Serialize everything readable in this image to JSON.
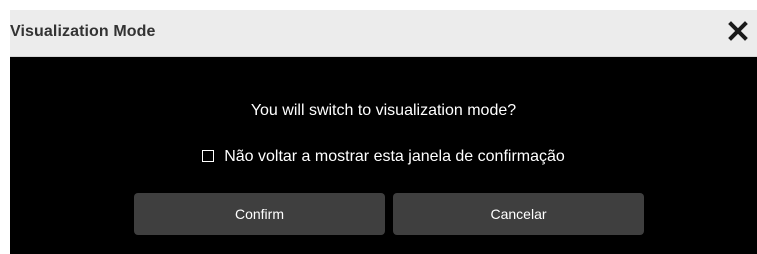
{
  "dialog": {
    "title": "Visualization Mode",
    "close_icon": "close-icon",
    "question": "You will switch to visualization mode?",
    "dont_show_label": "Não voltar a mostrar esta janela de confirmação",
    "dont_show_checked": false,
    "confirm_label": "Confirm",
    "cancel_label": "Cancelar"
  },
  "colors": {
    "titlebar_bg": "#ececec",
    "body_bg": "#000000",
    "button_bg": "#3f3f3f",
    "text_light": "#ffffff",
    "title_text": "#333333"
  }
}
